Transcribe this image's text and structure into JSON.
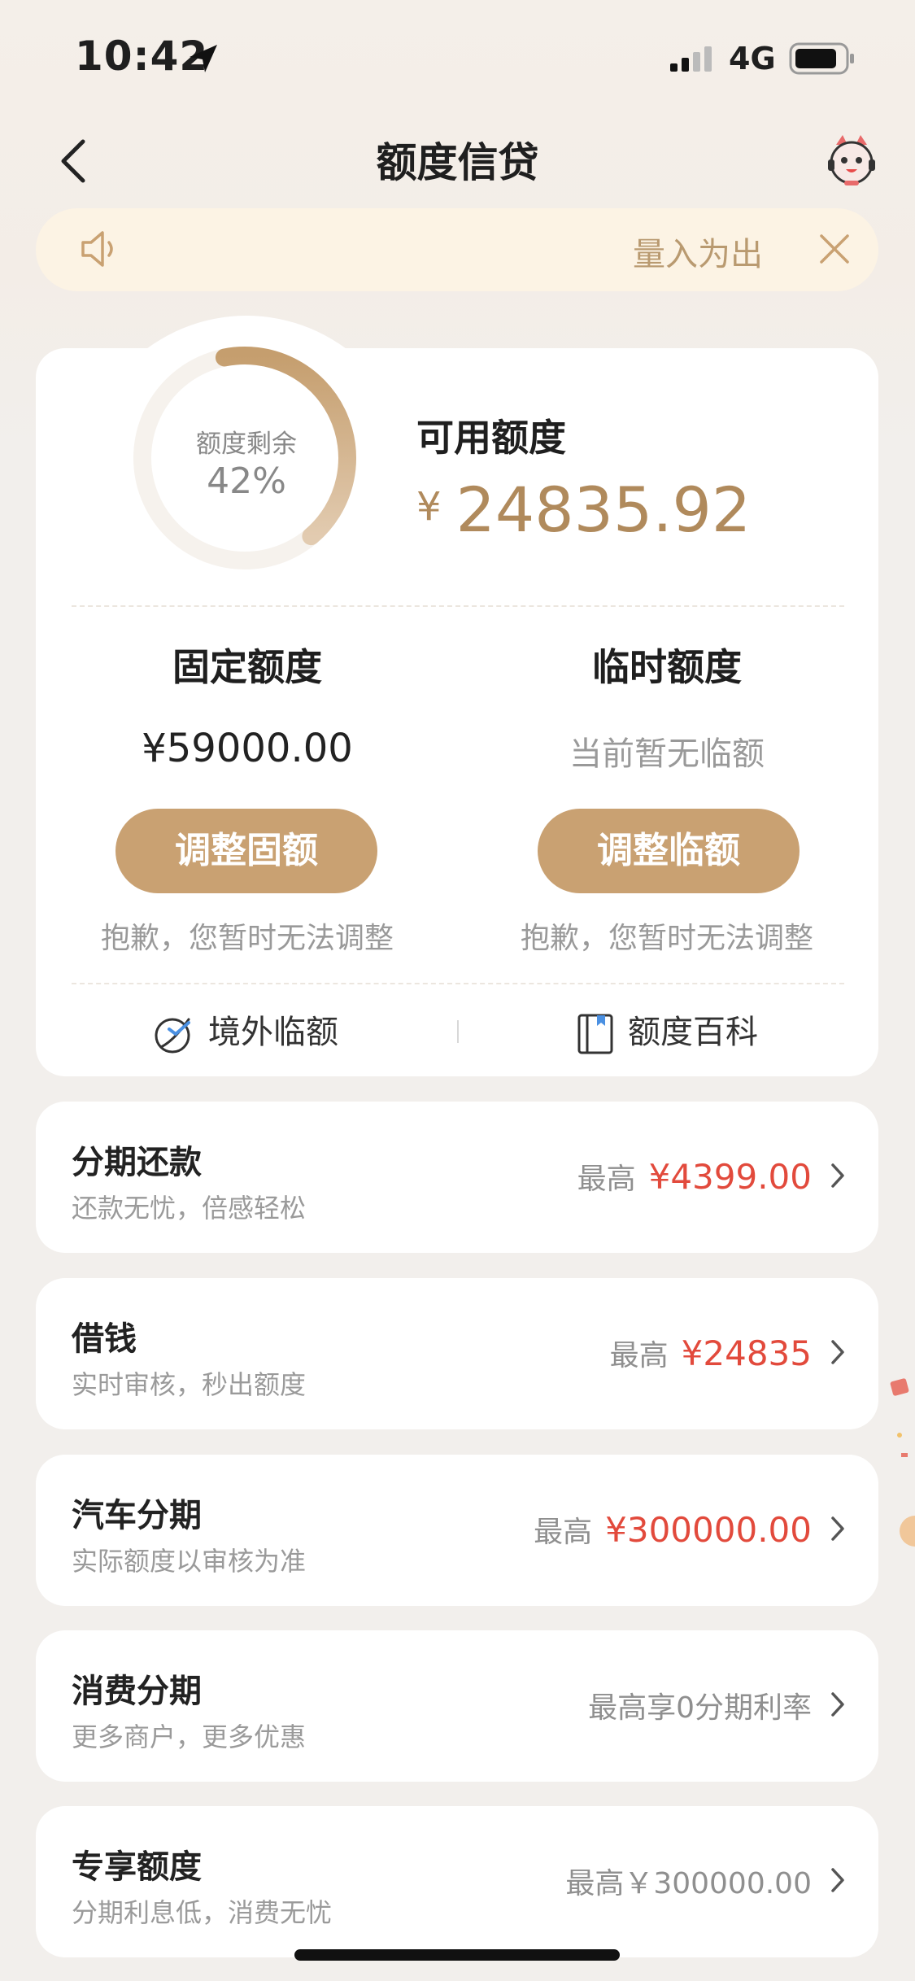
{
  "status_bar": {
    "time": "10:42",
    "network": "4G"
  },
  "nav": {
    "title": "额度信贷"
  },
  "notice": {
    "text": "量入为出"
  },
  "credit": {
    "ring_label": "额度剩余",
    "ring_percent": "42%",
    "remaining_fraction": 0.42,
    "available_label": "可用额度",
    "currency": "¥",
    "available_amount": "24835.92"
  },
  "fixed": {
    "title": "固定额度",
    "value": "¥59000.00",
    "button": "调整固额",
    "note": "抱歉，您暂时无法调整"
  },
  "temp": {
    "title": "临时额度",
    "value": "当前暂无临额",
    "button": "调整临额",
    "note": "抱歉，您暂时无法调整"
  },
  "links": {
    "overseas": "境外临额",
    "wiki": "额度百科"
  },
  "products": [
    {
      "name": "分期还款",
      "desc": "还款无忧，倍感轻松",
      "prefix": "最高",
      "amount": "¥4399.00"
    },
    {
      "name": "借钱",
      "desc": "实时审核，秒出额度",
      "prefix": "最高",
      "amount": "¥24835"
    },
    {
      "name": "汽车分期",
      "desc": "实际额度以审核为准",
      "prefix": "最高",
      "amount": "¥300000.00"
    },
    {
      "name": "消费分期",
      "desc": "更多商户，更多优惠",
      "prefix": "最高享0分期利率",
      "amount": ""
    },
    {
      "name": "专享额度",
      "desc": "分期利息低，消费无忧",
      "prefix": "最高￥300000.00",
      "amount": ""
    }
  ],
  "colors": {
    "accent": "#c9a172",
    "gold_text": "#b08a5c",
    "red": "#e24a3c",
    "background": "#f2efec"
  }
}
